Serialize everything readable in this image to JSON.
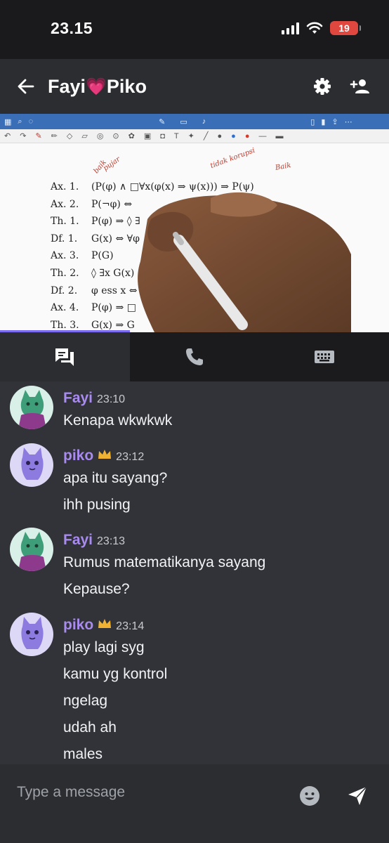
{
  "status": {
    "time": "23.15",
    "battery": "19"
  },
  "header": {
    "title_left": "Fayi",
    "title_heart": "💗",
    "title_right": "Piko",
    "icons": [
      "arrow-left-icon",
      "gear-icon",
      "add-person-icon"
    ]
  },
  "video": {
    "rows": [
      {
        "label": "Ax. 1.",
        "formula": "(P(φ) ∧ □∀x(φ(x) ⇒ ψ(x))) ⇒ P(ψ)"
      },
      {
        "label": "Ax. 2.",
        "formula": "P(¬φ) ⇔"
      },
      {
        "label": "Th. 1.",
        "formula": "P(φ) ⇒ ◊ ∃"
      },
      {
        "label": "Df. 1.",
        "formula": "G(x) ⇔ ∀φ"
      },
      {
        "label": "Ax. 3.",
        "formula": "P(G)"
      },
      {
        "label": "Th. 2.",
        "formula": "◊ ∃x G(x)"
      },
      {
        "label": "Df. 2.",
        "formula": "φ ess x ⇔"
      },
      {
        "label": "Ax. 4.",
        "formula": "P(φ) ⇒ □"
      },
      {
        "label": "Th. 3.",
        "formula": "G(x) ⇒ G"
      }
    ],
    "notes": [
      "baik",
      "pujar",
      "tidak korupsi",
      "Baik"
    ]
  },
  "tabs": [
    {
      "name": "chat",
      "icon": "chat-bubbles-icon",
      "active": true
    },
    {
      "name": "call",
      "icon": "phone-icon",
      "active": false
    },
    {
      "name": "keyboard",
      "icon": "keyboard-icon",
      "active": false
    }
  ],
  "messages": [
    {
      "author": "Fayi",
      "time": "23:10",
      "crown": false,
      "avatar": "green-cat-avatar",
      "lines": [
        "Kenapa wkwkwk"
      ]
    },
    {
      "author": "piko",
      "time": "23:12",
      "crown": true,
      "avatar": "purple-cat-avatar",
      "lines": [
        "apa itu sayang?",
        "ihh pusing"
      ]
    },
    {
      "author": "Fayi",
      "time": "23:13",
      "crown": false,
      "avatar": "green-cat-avatar",
      "lines": [
        "Rumus matematikanya sayang",
        "Kepause?"
      ]
    },
    {
      "author": "piko",
      "time": "23:14",
      "crown": true,
      "avatar": "purple-cat-avatar",
      "lines": [
        "play lagi syg",
        "kamu yg kontrol",
        "ngelag",
        "udah ah",
        "males"
      ]
    }
  ],
  "composer": {
    "placeholder": "Type a message"
  },
  "colors": {
    "accent": "#7c6cf0",
    "author": "#a98bf0",
    "crown": "#f0b232",
    "background": "#313338"
  }
}
